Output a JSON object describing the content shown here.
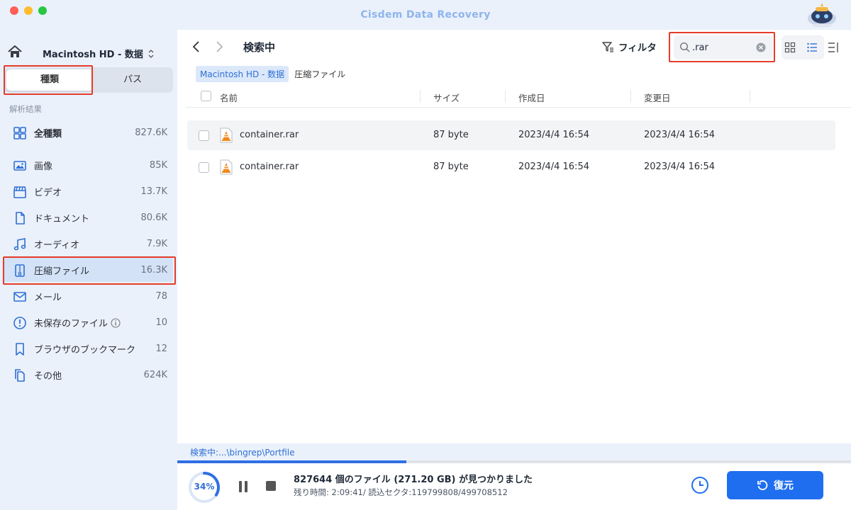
{
  "window": {
    "title": "Cisdem Data Recovery"
  },
  "sidebar": {
    "drive_name": "Macintosh HD - 数据",
    "tabs": {
      "kind": "種類",
      "path": "パス"
    },
    "section_label": "解析結果",
    "categories": [
      {
        "label": "全種類",
        "count": "827.6K"
      },
      {
        "label": "画像",
        "count": "85K"
      },
      {
        "label": "ビデオ",
        "count": "13.7K"
      },
      {
        "label": "ドキュメント",
        "count": "80.6K"
      },
      {
        "label": "オーディオ",
        "count": "7.9K"
      },
      {
        "label": "圧縮ファイル",
        "count": "16.3K"
      },
      {
        "label": "メール",
        "count": "78"
      },
      {
        "label": "未保存のファイル",
        "count": "10"
      },
      {
        "label": "ブラウザのブックマーク",
        "count": "12"
      },
      {
        "label": "その他",
        "count": "624K"
      }
    ]
  },
  "toolbar": {
    "title": "検索中",
    "filter_label": "フィルタ",
    "search_value": ".rar"
  },
  "breadcrumb": {
    "drive": "Macintosh  HD - 数据",
    "folder": "圧縮ファイル"
  },
  "table": {
    "columns": {
      "name": "名前",
      "size": "サイズ",
      "created": "作成日",
      "modified": "変更日"
    },
    "rows": [
      {
        "name": "container.rar",
        "size": "87 byte",
        "created": "2023/4/4 16:54",
        "modified": "2023/4/4 16:54"
      },
      {
        "name": "container.rar",
        "size": "87 byte",
        "created": "2023/4/4 16:54",
        "modified": "2023/4/4 16:54"
      }
    ]
  },
  "scan": {
    "status_path": "検索中:...\\bingrep\\Portfile",
    "progress_percent": 34,
    "progress_label": "34%",
    "found_text": "827644 個のファイル (271.20 GB) が見つかりました",
    "remaining_text": "残り時間: 2:09:41/ 読込セクタ:119799808/499708512"
  },
  "actions": {
    "recover_label": "復元"
  },
  "colors": {
    "accent": "#1f6ef0",
    "highlight": "#e53c2a",
    "sidebar_bg": "#eaf1fb"
  }
}
